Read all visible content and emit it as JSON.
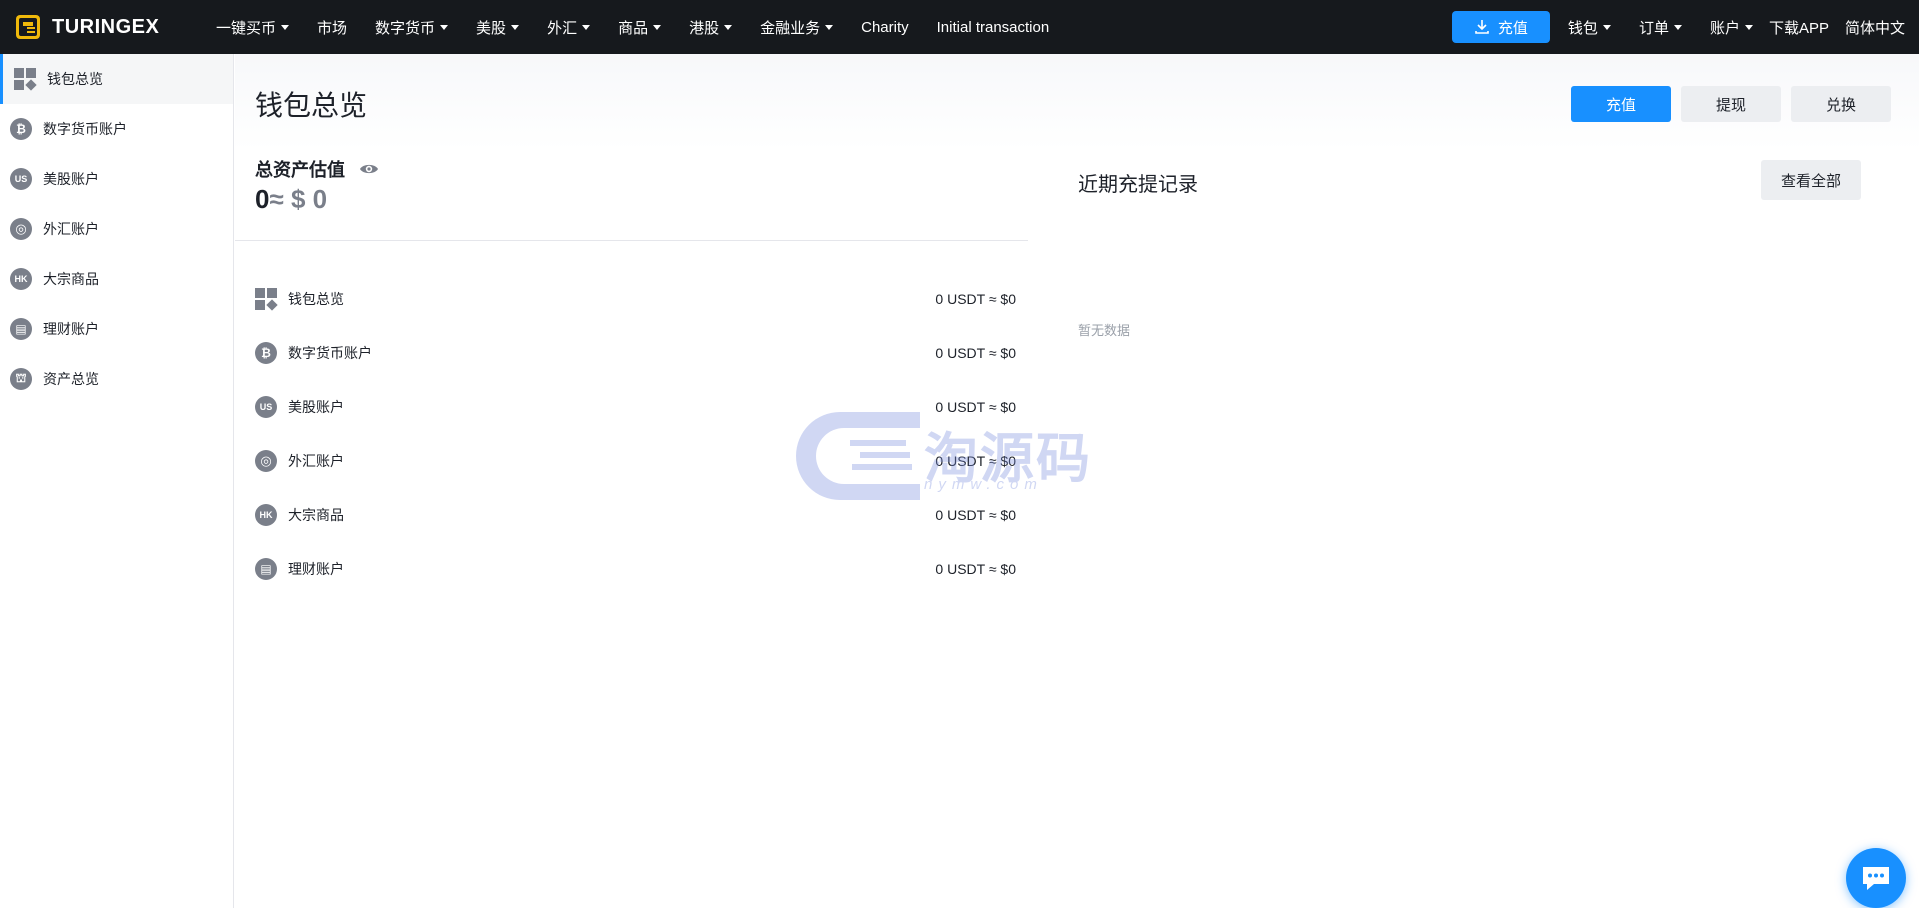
{
  "brand": {
    "name": "TURINGEX"
  },
  "nav": {
    "items": [
      {
        "label": "一键买币",
        "dropdown": true
      },
      {
        "label": "市场",
        "dropdown": false
      },
      {
        "label": "数字货币",
        "dropdown": true
      },
      {
        "label": "美股",
        "dropdown": true
      },
      {
        "label": "外汇",
        "dropdown": true
      },
      {
        "label": "商品",
        "dropdown": true
      },
      {
        "label": "港股",
        "dropdown": true
      },
      {
        "label": "金融业务",
        "dropdown": true
      },
      {
        "label": "Charity",
        "dropdown": false
      },
      {
        "label": "Initial transaction",
        "dropdown": false
      }
    ],
    "right": {
      "deposit": "充值",
      "wallet": "钱包",
      "orders": "订单",
      "account": "账户",
      "download": "下载APP",
      "language": "简体中文"
    }
  },
  "sidebar": {
    "items": [
      {
        "label": "钱包总览",
        "icon": "grid-icon",
        "badge": ""
      },
      {
        "label": "数字货币账户",
        "icon": "bitcoin-icon",
        "badge": "₿"
      },
      {
        "label": "美股账户",
        "icon": "us-icon",
        "badge": "US"
      },
      {
        "label": "外汇账户",
        "icon": "globe-icon",
        "badge": "◎"
      },
      {
        "label": "大宗商品",
        "icon": "hk-icon",
        "badge": "HK"
      },
      {
        "label": "理财账户",
        "icon": "finance-icon",
        "badge": "▤"
      },
      {
        "label": "资产总览",
        "icon": "assets-icon",
        "badge": "⛫"
      }
    ]
  },
  "main": {
    "title": "钱包总览",
    "buttons": {
      "deposit": "充值",
      "withdraw": "提现",
      "exchange": "兑换"
    },
    "total_assets": {
      "label": "总资产估值",
      "value": "0",
      "approx": "≈",
      "usd": "$ 0"
    },
    "accounts": [
      {
        "name": "钱包总览",
        "value": "0 USDT ≈ $0"
      },
      {
        "name": "数字货币账户",
        "value": "0 USDT ≈ $0"
      },
      {
        "name": "美股账户",
        "value": "0 USDT ≈ $0"
      },
      {
        "name": "外汇账户",
        "value": "0 USDT ≈ $0"
      },
      {
        "name": "大宗商品",
        "value": "0 USDT ≈ $0"
      },
      {
        "name": "理财账户",
        "value": "0 USDT ≈ $0"
      }
    ],
    "recent": {
      "title": "近期充提记录",
      "view_all": "查看全部",
      "empty": "暂无数据"
    }
  },
  "watermark": {
    "text": "淘源码",
    "sub": "nymw.com"
  },
  "colors": {
    "accent": "#1890ff",
    "topbar": "#16191d",
    "icon_grey": "#7a7f8a"
  }
}
